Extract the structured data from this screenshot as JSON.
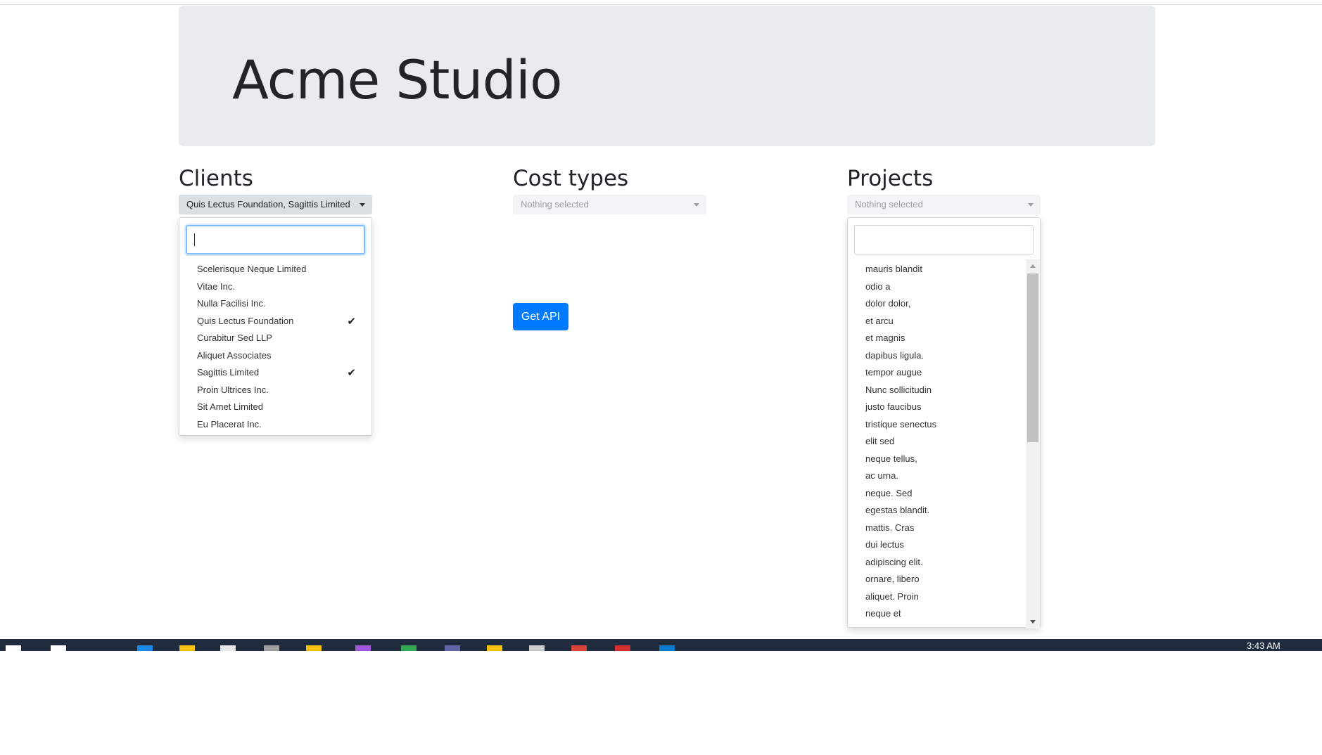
{
  "header": {
    "title": "Acme Studio"
  },
  "clients": {
    "title": "Clients",
    "selected_text": "Quis Lectus Foundation, Sagittis Limited",
    "search_value": "",
    "check_glyph": "✔",
    "options": [
      {
        "label": "Scelerisque Neque Limited",
        "selected": false
      },
      {
        "label": "Vitae Inc.",
        "selected": false
      },
      {
        "label": "Nulla Facilisi Inc.",
        "selected": false
      },
      {
        "label": "Quis Lectus Foundation",
        "selected": true
      },
      {
        "label": "Curabitur Sed LLP",
        "selected": false
      },
      {
        "label": "Aliquet Associates",
        "selected": false
      },
      {
        "label": "Sagittis Limited",
        "selected": true
      },
      {
        "label": "Proin Ultrices Inc.",
        "selected": false
      },
      {
        "label": "Sit Amet Limited",
        "selected": false
      },
      {
        "label": "Eu Placerat Inc.",
        "selected": false
      }
    ]
  },
  "cost_types": {
    "title": "Cost types",
    "selected_text": "Nothing selected"
  },
  "actions": {
    "get_api_label": "Get API"
  },
  "projects": {
    "title": "Projects",
    "selected_text": "Nothing selected",
    "search_value": "",
    "options": [
      "mauris blandit",
      "odio a",
      "dolor dolor,",
      "et arcu",
      "et magnis",
      "dapibus ligula.",
      "tempor augue",
      "Nunc sollicitudin",
      "justo faucibus",
      "tristique senectus",
      "elit sed",
      "neque tellus,",
      "ac urna.",
      "neque. Sed",
      "egestas blandit.",
      "mattis. Cras",
      "dui lectus",
      "adipiscing elit.",
      "ornare, libero",
      "aliquet. Proin",
      "neque et"
    ]
  },
  "taskbar": {
    "clock": "3:43 AM",
    "icons": [
      {
        "name": "windows-start-icon",
        "color": "#ffffff"
      },
      {
        "name": "search-icon",
        "color": "#ffffff"
      },
      {
        "name": "mail-app-icon",
        "color": "#1e88e5"
      },
      {
        "name": "file-explorer-icon",
        "color": "#f4c20d"
      },
      {
        "name": "paint-app-icon",
        "color": "#e8e8e8"
      },
      {
        "name": "calculator-icon",
        "color": "#9e9e9e"
      },
      {
        "name": "sticky-notes-icon",
        "color": "#f4c20d"
      },
      {
        "name": "onenote-icon",
        "color": "#a259d9"
      },
      {
        "name": "green-app-icon",
        "color": "#34a853"
      },
      {
        "name": "teams-icon",
        "color": "#6264a7"
      },
      {
        "name": "folder-app-icon",
        "color": "#f4c20d"
      },
      {
        "name": "generic-app-icon",
        "color": "#cccccc"
      },
      {
        "name": "chrome-icon",
        "color": "#db4437"
      },
      {
        "name": "acrobat-icon",
        "color": "#d32f2f"
      },
      {
        "name": "vscode-icon",
        "color": "#0a7acc"
      }
    ]
  }
}
